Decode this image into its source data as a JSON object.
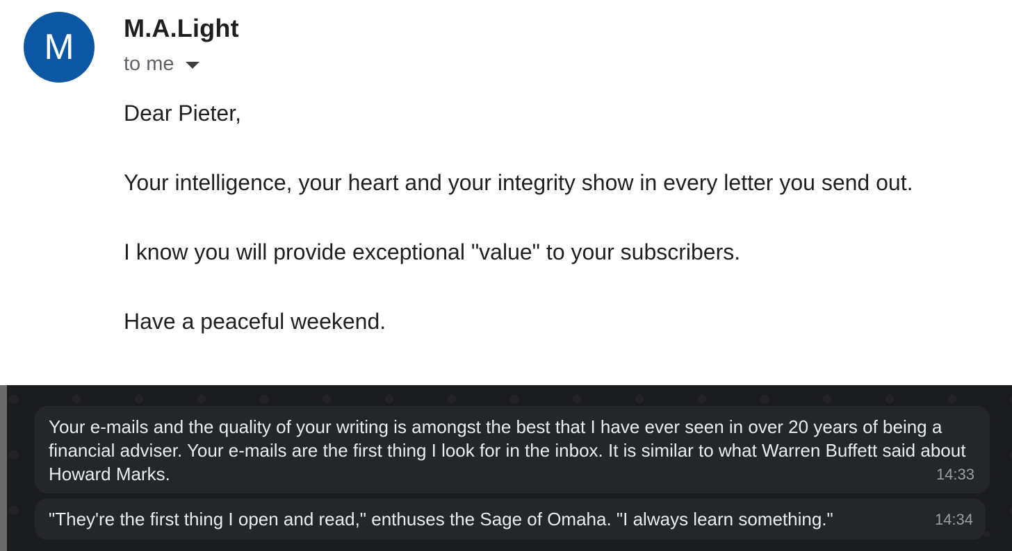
{
  "email": {
    "avatar_letter": "M",
    "sender_name": "M.A.Light",
    "recipient_label": "to me",
    "body": [
      "Dear Pieter,",
      "Your intelligence, your heart and your integrity show in every letter you send out.",
      "I know you will provide exceptional \"value\" to your subscribers.",
      "Have a peaceful weekend."
    ]
  },
  "chat": {
    "messages": [
      {
        "text": "Your e-mails and the quality of your writing is amongst the best that I have ever seen in over 20 years of being a financial adviser. Your e-mails are the first thing I look for in the inbox. It is similar to what Warren Buffett said about Howard Marks.",
        "time": "14:33"
      },
      {
        "text": "\"They're the first thing I open and read,\" enthuses the Sage of Omaha. \"I always learn something.\"",
        "time": "14:34"
      }
    ]
  },
  "colors": {
    "avatar_bg": "#0b57a4",
    "chat_bg": "#1b1c1e",
    "bubble_bg": "#242628"
  },
  "icons": {
    "recipient_details": "caret-down-icon"
  }
}
